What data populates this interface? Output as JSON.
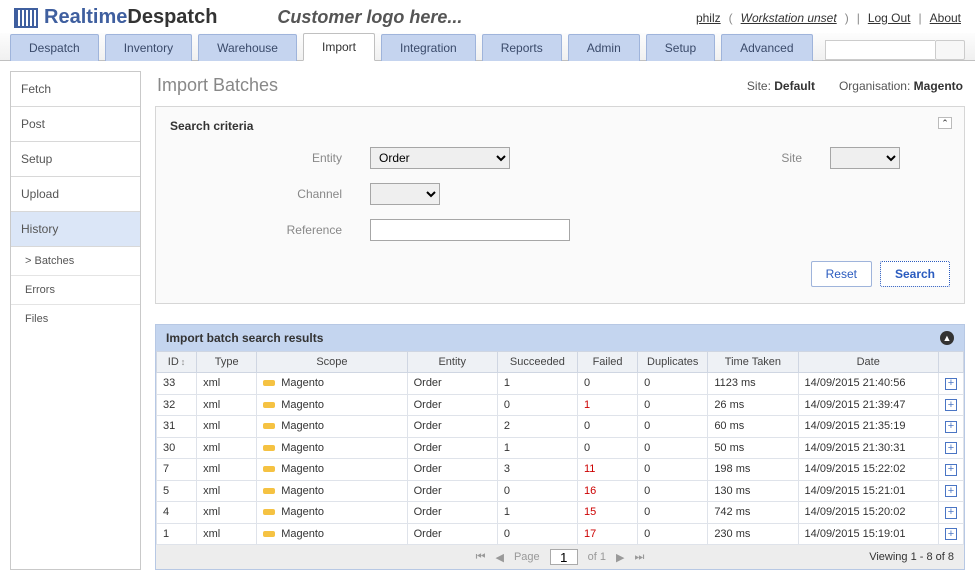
{
  "header": {
    "logo_realtime": "Realtime",
    "logo_despatch": "Despatch",
    "customer_logo": "Customer logo here...",
    "user": "philz",
    "workstation": "Workstation unset",
    "logout": "Log Out",
    "about": "About"
  },
  "tabs": [
    "Despatch",
    "Inventory",
    "Warehouse",
    "Import",
    "Integration",
    "Reports",
    "Admin",
    "Setup",
    "Advanced"
  ],
  "active_tab": "Import",
  "sidebar": {
    "items": [
      "Fetch",
      "Post",
      "Setup",
      "Upload",
      "History"
    ],
    "active": "History",
    "subs": [
      "> Batches",
      "Errors",
      "Files"
    ]
  },
  "page": {
    "title": "Import Batches",
    "site_label": "Site:",
    "site_value": "Default",
    "org_label": "Organisation:",
    "org_value": "Magento"
  },
  "search_panel": {
    "title": "Search criteria",
    "entity_label": "Entity",
    "entity_value": "Order",
    "site_label": "Site",
    "site_value": "",
    "channel_label": "Channel",
    "channel_value": "",
    "reference_label": "Reference",
    "reference_value": "",
    "reset": "Reset",
    "search": "Search"
  },
  "results": {
    "title": "Import batch search results",
    "columns": [
      "ID",
      "Type",
      "Scope",
      "Entity",
      "Succeeded",
      "Failed",
      "Duplicates",
      "Time Taken",
      "Date",
      ""
    ],
    "rows": [
      {
        "id": "33",
        "type": "xml",
        "scope": "Magento",
        "entity": "Order",
        "succeeded": "1",
        "failed": "0",
        "duplicates": "0",
        "time": "1123 ms",
        "date": "14/09/2015 21:40:56"
      },
      {
        "id": "32",
        "type": "xml",
        "scope": "Magento",
        "entity": "Order",
        "succeeded": "0",
        "failed": "1",
        "duplicates": "0",
        "time": "26 ms",
        "date": "14/09/2015 21:39:47"
      },
      {
        "id": "31",
        "type": "xml",
        "scope": "Magento",
        "entity": "Order",
        "succeeded": "2",
        "failed": "0",
        "duplicates": "0",
        "time": "60 ms",
        "date": "14/09/2015 21:35:19"
      },
      {
        "id": "30",
        "type": "xml",
        "scope": "Magento",
        "entity": "Order",
        "succeeded": "1",
        "failed": "0",
        "duplicates": "0",
        "time": "50 ms",
        "date": "14/09/2015 21:30:31"
      },
      {
        "id": "7",
        "type": "xml",
        "scope": "Magento",
        "entity": "Order",
        "succeeded": "3",
        "failed": "11",
        "duplicates": "0",
        "time": "198 ms",
        "date": "14/09/2015 15:22:02"
      },
      {
        "id": "5",
        "type": "xml",
        "scope": "Magento",
        "entity": "Order",
        "succeeded": "0",
        "failed": "16",
        "duplicates": "0",
        "time": "130 ms",
        "date": "14/09/2015 15:21:01"
      },
      {
        "id": "4",
        "type": "xml",
        "scope": "Magento",
        "entity": "Order",
        "succeeded": "1",
        "failed": "15",
        "duplicates": "0",
        "time": "742 ms",
        "date": "14/09/2015 15:20:02"
      },
      {
        "id": "1",
        "type": "xml",
        "scope": "Magento",
        "entity": "Order",
        "succeeded": "0",
        "failed": "17",
        "duplicates": "0",
        "time": "230 ms",
        "date": "14/09/2015 15:19:01"
      }
    ],
    "pager": {
      "page_label_pre": "Page",
      "page_value": "1",
      "page_label_post": "of 1",
      "viewing": "Viewing 1 - 8 of 8"
    }
  }
}
